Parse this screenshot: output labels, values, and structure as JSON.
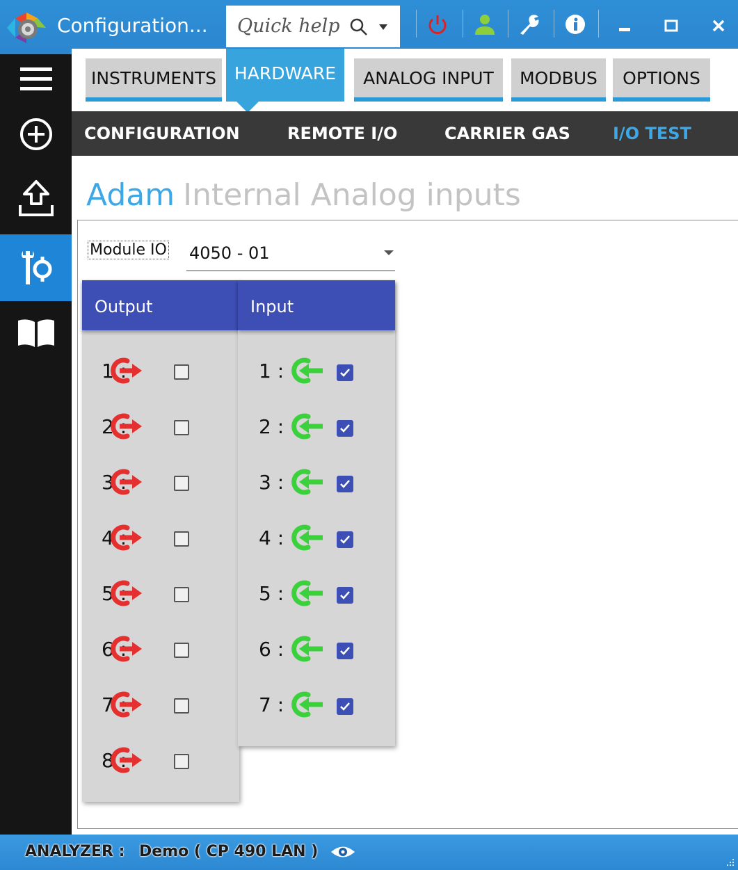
{
  "titlebar": {
    "title": "Configuration...",
    "quick_help_placeholder": "Quick help",
    "icons": [
      "app-logo",
      "search-icon",
      "power-icon",
      "user-icon",
      "wrench-icon",
      "info-icon",
      "minimize-icon",
      "maximize-icon",
      "close-icon"
    ]
  },
  "sidebar": {
    "items": [
      {
        "icon": "menu-icon"
      },
      {
        "icon": "add-icon"
      },
      {
        "icon": "upload-icon"
      },
      {
        "icon": "tools-icon",
        "active": true
      },
      {
        "icon": "book-icon"
      }
    ]
  },
  "tabs": [
    {
      "label": "INSTRUMENTS"
    },
    {
      "label": "HARDWARE",
      "active": true
    },
    {
      "label": "ANALOG INPUT"
    },
    {
      "label": "MODBUS"
    },
    {
      "label": "OPTIONS"
    }
  ],
  "subtabs": [
    {
      "label": "CONFIGURATION"
    },
    {
      "label": "REMOTE I/O"
    },
    {
      "label": "CARRIER GAS"
    },
    {
      "label": "I/O TEST",
      "active": true
    }
  ],
  "page": {
    "title_active": "Adam",
    "title_rest": "Internal Analog inputs"
  },
  "module": {
    "label": "Module IO",
    "value": "4050 - 01"
  },
  "output": {
    "header": "Output",
    "rows": [
      {
        "label": "1 :",
        "checked": false
      },
      {
        "label": "2 :",
        "checked": false
      },
      {
        "label": "3 :",
        "checked": false
      },
      {
        "label": "4 :",
        "checked": false
      },
      {
        "label": "5 :",
        "checked": false
      },
      {
        "label": "6 :",
        "checked": false
      },
      {
        "label": "7 :",
        "checked": false
      },
      {
        "label": "8 :",
        "checked": false
      }
    ]
  },
  "input": {
    "header": "Input",
    "rows": [
      {
        "label": "1 :",
        "checked": true
      },
      {
        "label": "2 :",
        "checked": true
      },
      {
        "label": "3 :",
        "checked": true
      },
      {
        "label": "4 :",
        "checked": true
      },
      {
        "label": "5 :",
        "checked": true
      },
      {
        "label": "6 :",
        "checked": true
      },
      {
        "label": "7 :",
        "checked": true
      }
    ]
  },
  "statusbar": {
    "label": "ANALYZER :",
    "value": "Demo ( CP 490 LAN )"
  },
  "colors": {
    "accent": "#38a4dd",
    "panel_header": "#3d4fb5",
    "output_icon": "#e53030",
    "input_icon": "#3cd13c"
  }
}
